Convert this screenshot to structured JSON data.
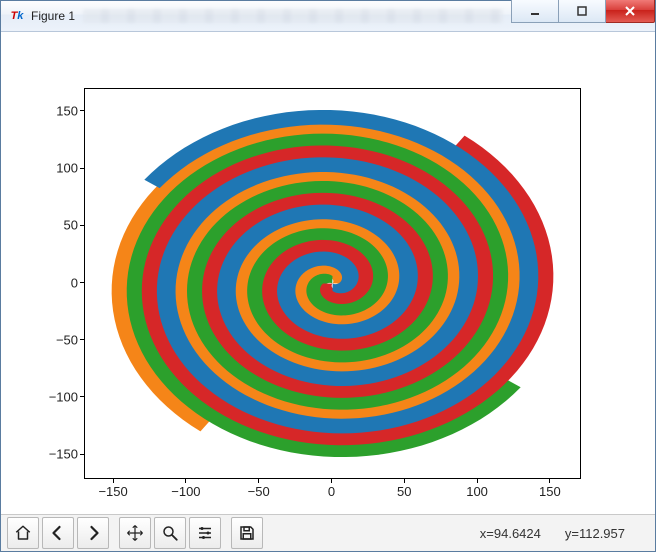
{
  "window": {
    "title": "Figure 1"
  },
  "toolbar_icons": [
    "home",
    "back",
    "forward",
    "pan",
    "zoom",
    "configure",
    "save"
  ],
  "status": {
    "x_label": "x=94.6424",
    "y_label": "y=112.957"
  },
  "chart_data": {
    "type": "area",
    "description": "Four interleaved Archimedean-spiral filled ribbons (square-spiral style), rotational offsets of 90° each.",
    "title": "",
    "xlabel": "",
    "ylabel": "",
    "xlim": [
      -170,
      170
    ],
    "ylim": [
      -170,
      170
    ],
    "xticks": [
      -150,
      -100,
      -50,
      0,
      50,
      100,
      150
    ],
    "yticks": [
      -150,
      -100,
      -50,
      0,
      50,
      100,
      150
    ],
    "series": [
      {
        "name": "spiral-orange",
        "color": "#f58518",
        "phase_deg": 0,
        "vertices_outer": [
          [
            0,
            0
          ],
          [
            0.83,
            0
          ],
          [
            0.83,
            2.5
          ],
          [
            -4.17,
            2.5
          ],
          [
            -4.17,
            -5.83
          ],
          [
            9.17,
            -5.83
          ],
          [
            9.17,
            12.5
          ],
          [
            -17.5,
            12.5
          ],
          [
            -17.5,
            -24.17
          ],
          [
            32.5,
            -24.17
          ],
          [
            32.5,
            40.84
          ],
          [
            -51.67,
            40.84
          ],
          [
            -51.67,
            -64.17
          ],
          [
            78.34,
            -64.17
          ],
          [
            78.34,
            94.17
          ],
          [
            -111.67,
            94.17
          ],
          [
            -111.67,
            -130.84
          ],
          [
            151.67,
            -130.84
          ]
        ],
        "vertices_inner": [
          [
            141.67,
            -123.34
          ],
          [
            -104.17,
            -123.34
          ],
          [
            -104.17,
            87.5
          ],
          [
            72.5,
            87.5
          ],
          [
            72.5,
            -58.34
          ],
          [
            -47.5,
            -58.34
          ],
          [
            -47.5,
            37.5
          ],
          [
            29.17,
            37.5
          ],
          [
            29.17,
            -20.84
          ],
          [
            -15,
            -20.84
          ],
          [
            -15,
            10.84
          ],
          [
            7.5,
            10.84
          ],
          [
            7.5,
            -4.17
          ],
          [
            -2.5,
            -4.17
          ],
          [
            -2.5,
            1.67
          ],
          [
            0,
            1.67
          ],
          [
            0,
            0
          ]
        ]
      },
      {
        "name": "spiral-green",
        "color": "#2ca02c",
        "phase_deg": 90,
        "vertices_outer": [
          [
            0,
            0
          ],
          [
            0,
            0.83
          ],
          [
            -2.5,
            0.83
          ],
          [
            -2.5,
            -4.17
          ],
          [
            5.83,
            -4.17
          ],
          [
            5.83,
            9.17
          ],
          [
            -12.5,
            9.17
          ],
          [
            -12.5,
            -17.5
          ],
          [
            24.17,
            -17.5
          ],
          [
            24.17,
            32.5
          ],
          [
            -40.84,
            32.5
          ],
          [
            -40.84,
            -51.67
          ],
          [
            64.17,
            -51.67
          ],
          [
            64.17,
            78.34
          ],
          [
            -94.17,
            78.34
          ],
          [
            -94.17,
            -111.67
          ],
          [
            130.84,
            -111.67
          ],
          [
            130.84,
            151.67
          ]
        ],
        "vertices_inner": [
          [
            123.34,
            141.67
          ],
          [
            123.34,
            -104.17
          ],
          [
            -87.5,
            -104.17
          ],
          [
            -87.5,
            72.5
          ],
          [
            58.34,
            72.5
          ],
          [
            58.34,
            -47.5
          ],
          [
            -37.5,
            -47.5
          ],
          [
            -37.5,
            29.17
          ],
          [
            20.84,
            29.17
          ],
          [
            20.84,
            -15
          ],
          [
            -10.84,
            -15
          ],
          [
            -10.84,
            7.5
          ],
          [
            4.17,
            7.5
          ],
          [
            4.17,
            -2.5
          ],
          [
            -1.67,
            -2.5
          ],
          [
            -1.67,
            0
          ],
          [
            0,
            0
          ]
        ]
      },
      {
        "name": "spiral-red",
        "color": "#d62728",
        "phase_deg": 180,
        "vertices_outer": [
          [
            0,
            0
          ],
          [
            -0.83,
            0
          ],
          [
            -0.83,
            -2.5
          ],
          [
            4.17,
            -2.5
          ],
          [
            4.17,
            5.83
          ],
          [
            -9.17,
            5.83
          ],
          [
            -9.17,
            -12.5
          ],
          [
            17.5,
            -12.5
          ],
          [
            17.5,
            24.17
          ],
          [
            -32.5,
            24.17
          ],
          [
            -32.5,
            -40.84
          ],
          [
            51.67,
            -40.84
          ],
          [
            51.67,
            64.17
          ],
          [
            -78.34,
            64.17
          ],
          [
            -78.34,
            -94.17
          ],
          [
            111.67,
            -94.17
          ],
          [
            111.67,
            130.84
          ],
          [
            -151.67,
            130.84
          ]
        ],
        "vertices_inner": [
          [
            -141.67,
            123.34
          ],
          [
            104.17,
            123.34
          ],
          [
            104.17,
            -87.5
          ],
          [
            -72.5,
            -87.5
          ],
          [
            -72.5,
            58.34
          ],
          [
            47.5,
            58.34
          ],
          [
            47.5,
            -37.5
          ],
          [
            -29.17,
            -37.5
          ],
          [
            -29.17,
            20.84
          ],
          [
            15,
            20.84
          ],
          [
            15,
            -10.84
          ],
          [
            -7.5,
            -10.84
          ],
          [
            -7.5,
            4.17
          ],
          [
            2.5,
            4.17
          ],
          [
            2.5,
            -1.67
          ],
          [
            0,
            -1.67
          ],
          [
            0,
            0
          ]
        ]
      },
      {
        "name": "spiral-blue",
        "color": "#1f77b4",
        "phase_deg": 270,
        "vertices_outer": [
          [
            0,
            0
          ],
          [
            0,
            -0.83
          ],
          [
            2.5,
            -0.83
          ],
          [
            2.5,
            4.17
          ],
          [
            -5.83,
            4.17
          ],
          [
            -5.83,
            -9.17
          ],
          [
            12.5,
            -9.17
          ],
          [
            12.5,
            17.5
          ],
          [
            -24.17,
            17.5
          ],
          [
            -24.17,
            -32.5
          ],
          [
            40.84,
            -32.5
          ],
          [
            40.84,
            51.67
          ],
          [
            -64.17,
            51.67
          ],
          [
            -64.17,
            -78.34
          ],
          [
            94.17,
            -78.34
          ],
          [
            94.17,
            111.67
          ],
          [
            -130.84,
            111.67
          ],
          [
            -130.84,
            -151.67
          ]
        ],
        "vertices_inner": [
          [
            -123.34,
            -141.67
          ],
          [
            -123.34,
            104.17
          ],
          [
            87.5,
            104.17
          ],
          [
            87.5,
            -72.5
          ],
          [
            -58.34,
            -72.5
          ],
          [
            -58.34,
            47.5
          ],
          [
            37.5,
            47.5
          ],
          [
            37.5,
            -29.17
          ],
          [
            -20.84,
            -29.17
          ],
          [
            -20.84,
            15
          ],
          [
            10.84,
            15
          ],
          [
            10.84,
            -7.5
          ],
          [
            -4.17,
            -7.5
          ],
          [
            -4.17,
            2.5
          ],
          [
            1.67,
            2.5
          ],
          [
            1.67,
            0
          ],
          [
            0,
            0
          ]
        ]
      }
    ]
  }
}
